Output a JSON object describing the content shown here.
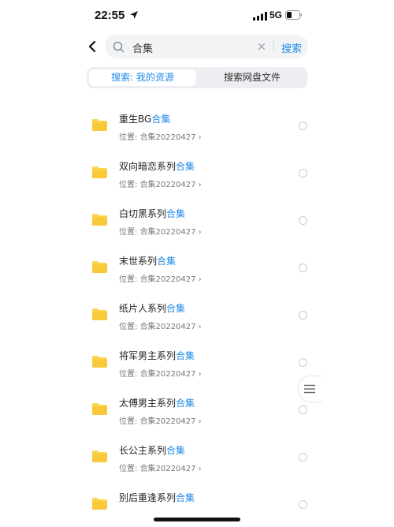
{
  "status": {
    "time": "22:55",
    "network": "5G"
  },
  "search": {
    "query": "合集",
    "button": "搜索"
  },
  "tabs": {
    "mine": "搜索: 我的资源",
    "cloud": "搜索网盘文件"
  },
  "location_prefix": "位置: ",
  "items": [
    {
      "name": "重生BG",
      "keyword": "合集",
      "path": "合集20220427 ›"
    },
    {
      "name": "双向暗恋系列",
      "keyword": "合集",
      "path": "合集20220427 ›"
    },
    {
      "name": "白切黑系列",
      "keyword": "合集",
      "path": "合集20220427 ›"
    },
    {
      "name": "末世系列",
      "keyword": "合集",
      "path": "合集20220427 ›"
    },
    {
      "name": "纸片人系列",
      "keyword": "合集",
      "path": "合集20220427 ›"
    },
    {
      "name": "将军男主系列",
      "keyword": "合集",
      "path": "合集20220427 ›"
    },
    {
      "name": "太傅男主系列",
      "keyword": "合集",
      "path": "合集20220427 ›"
    },
    {
      "name": "长公主系列",
      "keyword": "合集",
      "path": "合集20220427 ›"
    },
    {
      "name": "别后重逢系列",
      "keyword": "合集",
      "path": ""
    }
  ],
  "colors": {
    "accent": "#1f8ae8",
    "folder": "#fcd34d"
  },
  "icons": [
    "location-arrow-icon",
    "signal-icon",
    "battery-icon",
    "back-arrow-icon",
    "search-icon",
    "clear-icon",
    "folder-icon",
    "menu-icon"
  ]
}
